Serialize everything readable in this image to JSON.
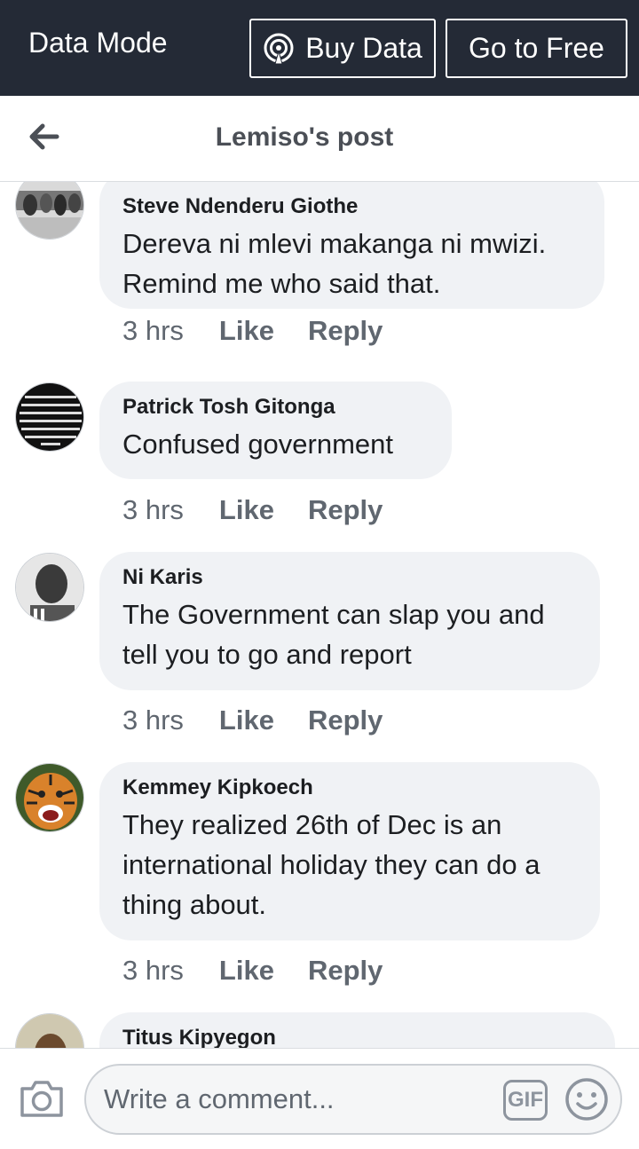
{
  "topbar": {
    "mode_label": "Data Mode",
    "buy_label": "Buy Data",
    "free_label": "Go to Free",
    "background": "#242a36"
  },
  "header": {
    "title": "Lemiso's post",
    "back_icon": "back-arrow-icon"
  },
  "comments": [
    {
      "author": "Steve Ndenderu Giothe",
      "text": "Dereva ni mlevi makanga ni mwizi.\nRemind me who said that.",
      "time": "3 hrs",
      "like": "Like",
      "reply": "Reply"
    },
    {
      "author": "Patrick Tosh Gitonga",
      "text": "Confused government",
      "time": "3 hrs",
      "like": "Like",
      "reply": "Reply"
    },
    {
      "author": "Ni Karis",
      "text": "The Government can slap you and\ntell you to go and report",
      "time": "3 hrs",
      "like": "Like",
      "reply": "Reply"
    },
    {
      "author": "Kemmey Kipkoech",
      "text": "They realized 26th of Dec is an\ninternational holiday they can do a\nthing about.",
      "time": "3 hrs",
      "like": "Like",
      "reply": "Reply"
    },
    {
      "author": "Titus Kipyegon"
    }
  ],
  "composer": {
    "placeholder": "Write a comment...",
    "gif_label": "GIF",
    "camera_icon": "camera-icon",
    "emoji_icon": "emoji-icon"
  }
}
